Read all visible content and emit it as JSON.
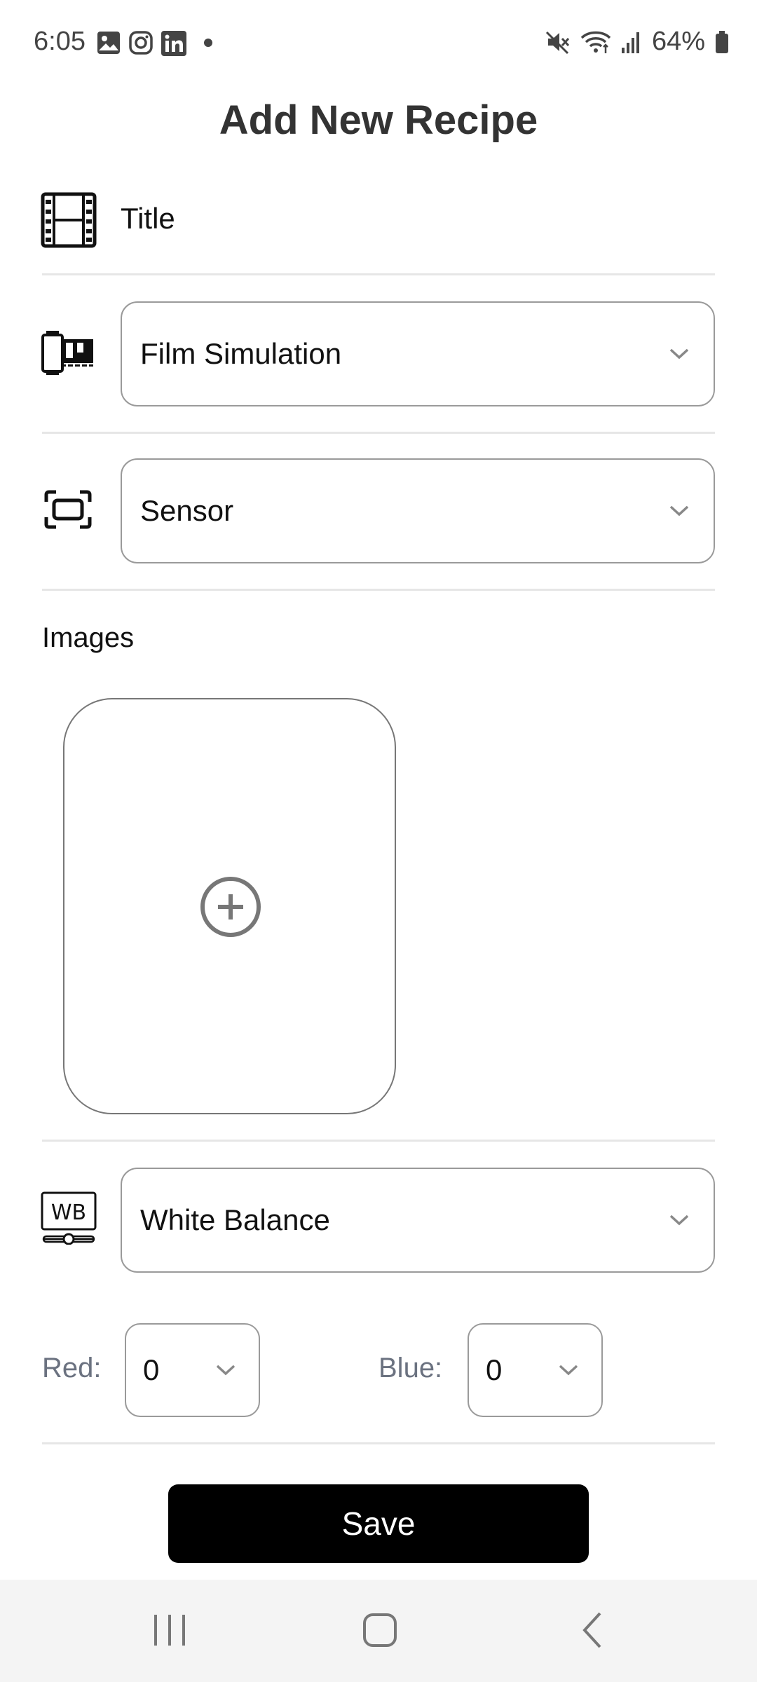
{
  "status_bar": {
    "time": "6:05",
    "left_icons": [
      "gallery-icon",
      "instagram-icon",
      "linkedin-icon",
      "dot-icon"
    ],
    "right_icons": [
      "mute-icon",
      "wifi-icon",
      "signal-icon"
    ],
    "battery": "64%"
  },
  "page": {
    "title": "Add New Recipe"
  },
  "form": {
    "title_placeholder": "Title",
    "film_simulation": {
      "label": "Film Simulation"
    },
    "sensor": {
      "label": "Sensor"
    },
    "images": {
      "label": "Images"
    },
    "white_balance": {
      "label": "White Balance"
    },
    "red": {
      "label": "Red:",
      "value": "0"
    },
    "blue": {
      "label": "Blue:",
      "value": "0"
    },
    "save_label": "Save"
  },
  "nav": {
    "recents": "recents-icon",
    "home": "home-icon",
    "back": "back-icon"
  }
}
